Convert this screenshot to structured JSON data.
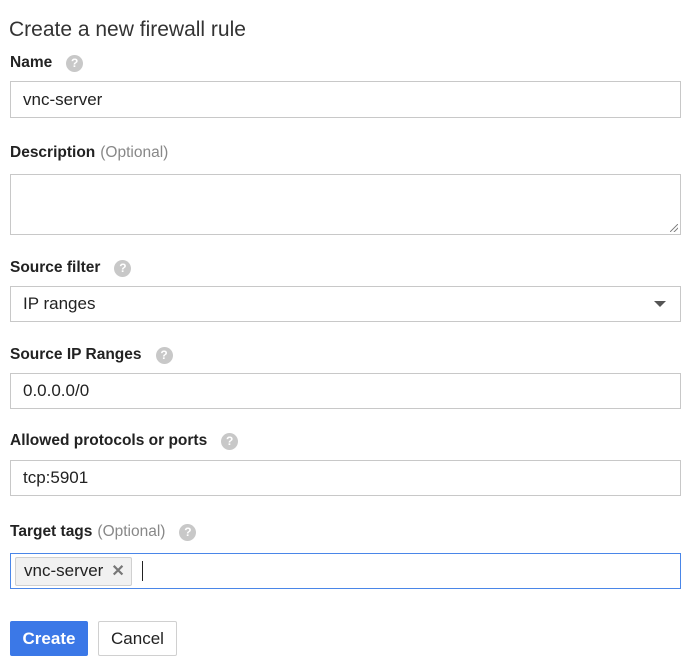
{
  "title": "Create a new firewall rule",
  "help_glyph": "?",
  "optional": "(Optional)",
  "name": {
    "label": "Name",
    "value": "vnc-server"
  },
  "description": {
    "label": "Description",
    "value": ""
  },
  "source_filter": {
    "label": "Source filter",
    "value": "IP ranges"
  },
  "source_ip": {
    "label": "Source IP Ranges",
    "value": "0.0.0.0/0"
  },
  "protocols": {
    "label": "Allowed protocols or ports",
    "value": "tcp:5901"
  },
  "target_tags": {
    "label": "Target tags",
    "tags": [
      "vnc-server"
    ],
    "remove_glyph": "✕"
  },
  "buttons": {
    "create": "Create",
    "cancel": "Cancel"
  }
}
